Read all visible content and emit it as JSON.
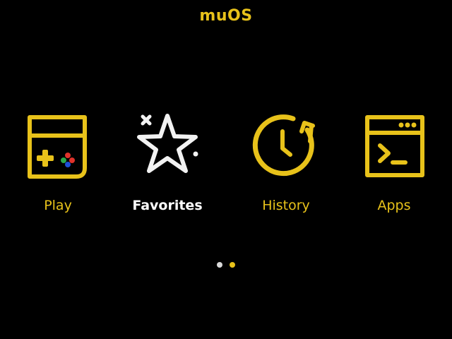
{
  "header": {
    "title": "muOS"
  },
  "menu": {
    "items": [
      {
        "id": "play",
        "label": "Play",
        "icon": "handheld-console-icon",
        "selected": false
      },
      {
        "id": "favorites",
        "label": "Favorites",
        "icon": "star-icon",
        "selected": true
      },
      {
        "id": "history",
        "label": "History",
        "icon": "clock-history-icon",
        "selected": false
      },
      {
        "id": "apps",
        "label": "Apps",
        "icon": "terminal-window-icon",
        "selected": false
      }
    ]
  },
  "pager": {
    "pages": 2,
    "current": 2
  },
  "colors": {
    "background": "#000000",
    "accent": "#E8C21A",
    "selected": "#F2F2F2",
    "pager_inactive": "#D9D9D9",
    "pager_active": "#E8C21A",
    "dpad_red": "#E0322B",
    "dpad_blue": "#1E4FD8",
    "dpad_green": "#2CA84A"
  }
}
